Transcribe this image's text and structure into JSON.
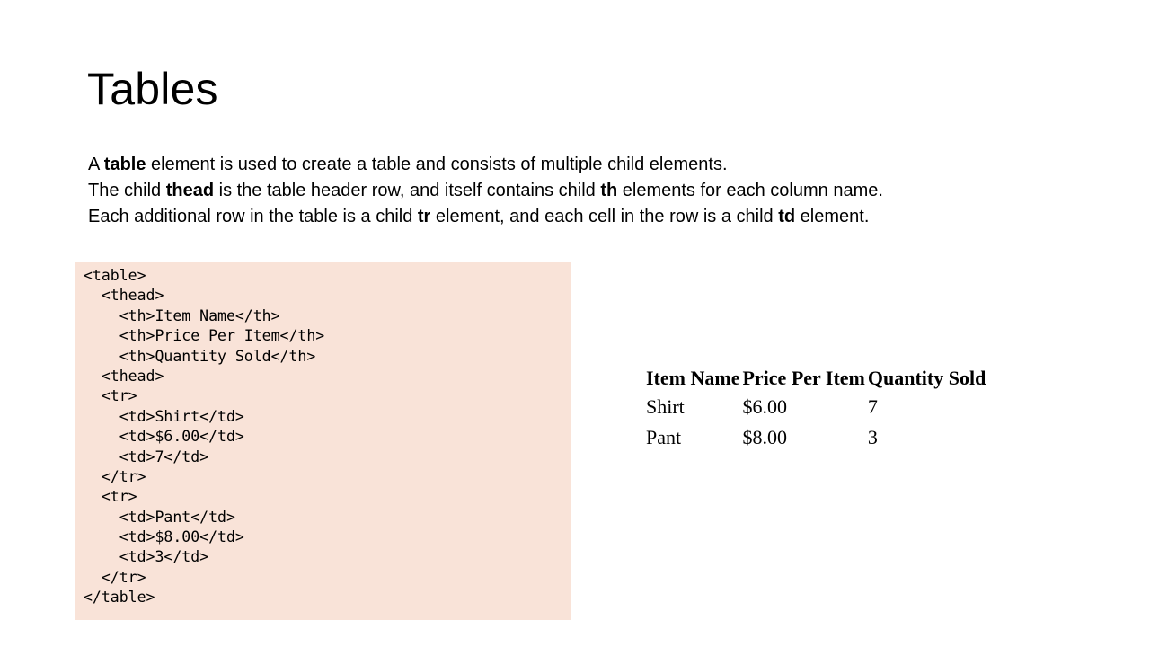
{
  "slide": {
    "title": "Tables"
  },
  "description": {
    "line1": {
      "a": "A ",
      "b": "table",
      "c": " element is used to create a table and consists of multiple child elements."
    },
    "line2": {
      "a": "The child ",
      "b": "thead",
      "c": " is the table header row, and itself contains child ",
      "d": "th",
      "e": " elements for each column name."
    },
    "line3": {
      "a": "Each additional row in the table is a child ",
      "b": "tr",
      "c": " element, and each cell in the row is a child ",
      "d": "td",
      "e": " element."
    }
  },
  "code_lines": [
    "<table>",
    "  <thead>",
    "    <th>Item Name</th>",
    "    <th>Price Per Item</th>",
    "    <th>Quantity Sold</th>",
    "  <thead>",
    "  <tr>",
    "    <td>Shirt</td>",
    "    <td>$6.00</td>",
    "    <td>7</td>",
    "  </tr>",
    "  <tr>",
    "    <td>Pant</td>",
    "    <td>$8.00</td>",
    "    <td>3</td>",
    "  </tr>",
    "</table>"
  ],
  "rendered_table": {
    "headers": [
      "Item Name",
      "Price Per Item",
      "Quantity Sold"
    ],
    "rows": [
      [
        "Shirt",
        "$6.00",
        "7"
      ],
      [
        "Pant",
        "$8.00",
        "3"
      ]
    ]
  },
  "colors": {
    "code_background": "#f9e3d8"
  }
}
